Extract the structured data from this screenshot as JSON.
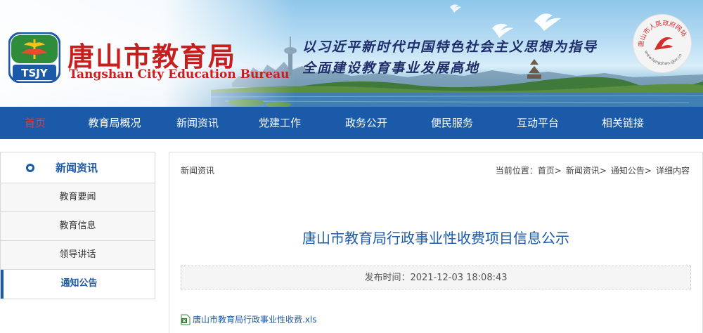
{
  "header": {
    "title": "唐山市教育局",
    "subtitle": "Tangshan City Education Bureau",
    "logo_text": "TSJY",
    "slogan_line1": "以习近平新时代中国特色社会主义思想为指导",
    "slogan_line2": "全面建设教育事业发展高地",
    "seal_text": "唐山市人民政府网站群成员",
    "seal_url": "www.tangshan.gov.cn"
  },
  "nav": {
    "items": [
      {
        "label": "首页",
        "active": true
      },
      {
        "label": "教育局概况"
      },
      {
        "label": "新闻资讯"
      },
      {
        "label": "党建工作"
      },
      {
        "label": "政务公开"
      },
      {
        "label": "便民服务"
      },
      {
        "label": "互动平台"
      },
      {
        "label": "相关链接"
      }
    ]
  },
  "sidebar": {
    "title": "新闻资讯",
    "items": [
      {
        "label": "教育要闻"
      },
      {
        "label": "教育信息"
      },
      {
        "label": "领导讲话"
      },
      {
        "label": "通知公告",
        "active": true
      }
    ]
  },
  "main": {
    "section_label": "新闻资讯",
    "breadcrumb_prefix": "当前位置：",
    "breadcrumb": [
      "首页>",
      "新闻资讯>",
      "通知公告>",
      "详细内容"
    ],
    "article_title": "唐山市教育局行政事业性收费项目信息公示",
    "publish": "发布时间：2021-12-03 18:08:43",
    "attachment": "唐山市教育局行政事业性收费.xls"
  },
  "colors": {
    "brand_blue": "#1b5aa9",
    "brand_red": "#c81e1e",
    "nav_active": "#e23a3a"
  },
  "icons": [
    "logo-icon",
    "bird-icon",
    "seal-icon",
    "circle-dot-icon",
    "excel-file-icon"
  ]
}
